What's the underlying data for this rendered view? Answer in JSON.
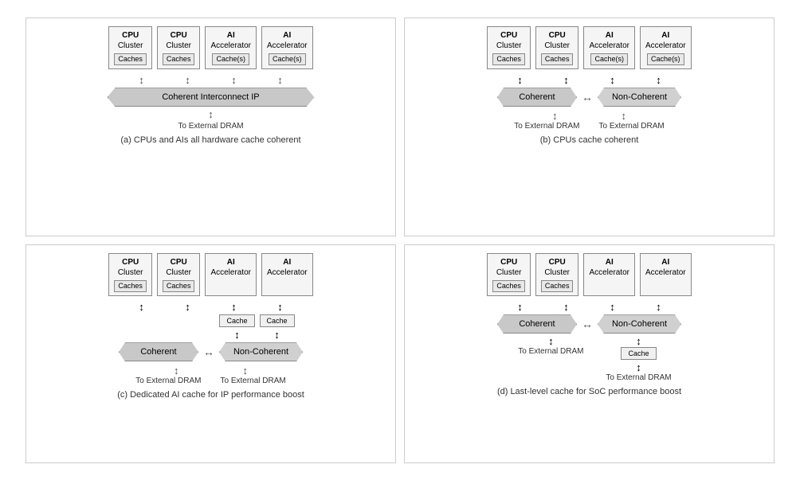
{
  "diagrams": {
    "a": {
      "title": "(a) CPUs and AIs all hardware cache coherent",
      "units": [
        {
          "title": "CPU",
          "sub": "Cluster",
          "cache": "Caches"
        },
        {
          "title": "CPU",
          "sub": "Cluster",
          "cache": "Caches"
        },
        {
          "title": "AI",
          "sub": "Accelerator",
          "cache": "Cache(s)"
        },
        {
          "title": "AI",
          "sub": "Accelerator",
          "cache": "Cache(s)"
        }
      ],
      "banner": "Coherent Interconnect IP",
      "dram": "To External DRAM"
    },
    "b": {
      "title": "(b) CPUs cache coherent",
      "units": [
        {
          "title": "CPU",
          "sub": "Cluster",
          "cache": "Caches"
        },
        {
          "title": "CPU",
          "sub": "Cluster",
          "cache": "Caches"
        },
        {
          "title": "AI",
          "sub": "Accelerator",
          "cache": "Cache(s)"
        },
        {
          "title": "AI",
          "sub": "Accelerator",
          "cache": "Cache(s)"
        }
      ],
      "banner_left": "Coherent",
      "banner_right": "Non-Coherent",
      "dram_left": "To External DRAM",
      "dram_right": "To External DRAM"
    },
    "c": {
      "title": "(c) Dedicated AI cache for IP performance boost",
      "units": [
        {
          "title": "CPU",
          "sub": "Cluster",
          "cache": "Caches"
        },
        {
          "title": "CPU",
          "sub": "Cluster",
          "cache": "Caches"
        },
        {
          "title": "AI",
          "sub": "Accelerator",
          "cache": null
        },
        {
          "title": "AI",
          "sub": "Accelerator",
          "cache": null
        }
      ],
      "mid_cache": "Cache",
      "banner_left": "Coherent",
      "banner_right": "Non-Coherent",
      "dram_left": "To External DRAM",
      "dram_right": "To External DRAM"
    },
    "d": {
      "title": "(d) Last-level cache for SoC performance boost",
      "units": [
        {
          "title": "CPU",
          "sub": "Cluster",
          "cache": "Caches"
        },
        {
          "title": "CPU",
          "sub": "Cluster",
          "cache": "Caches"
        },
        {
          "title": "AI",
          "sub": "Accelerator",
          "cache": null
        },
        {
          "title": "AI",
          "sub": "Accelerator",
          "cache": null
        }
      ],
      "banner_left": "Coherent",
      "banner_right": "Non-Coherent",
      "bottom_cache": "Cache",
      "dram_left": "To External DRAM",
      "dram_right": "To External DRAM"
    }
  }
}
